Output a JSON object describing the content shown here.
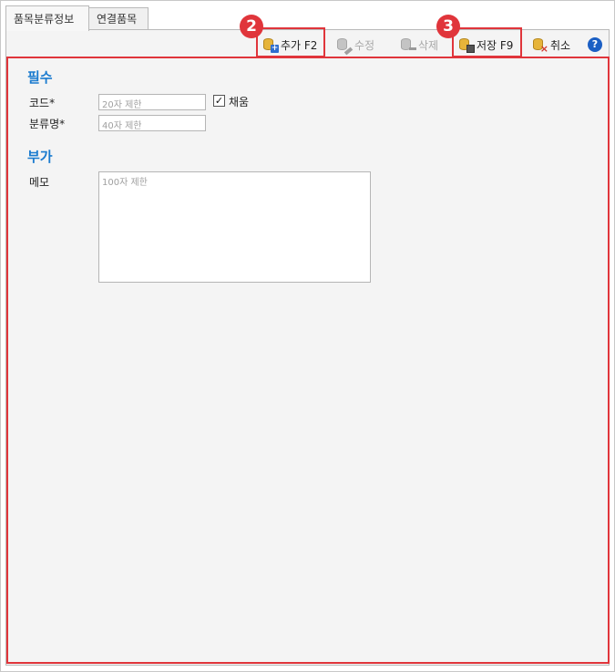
{
  "tabs": [
    {
      "label": "품목분류정보",
      "active": true
    },
    {
      "label": "연결품목",
      "active": false
    }
  ],
  "toolbar": {
    "add_label": "추가 F2",
    "edit_label": "수정",
    "delete_label": "삭제",
    "save_label": "저장 F9",
    "cancel_label": "취소",
    "help_glyph": "?"
  },
  "callouts": {
    "marker_2": "2",
    "marker_3": "3",
    "color": "#e0353b"
  },
  "required_section": {
    "title": "필수",
    "code": {
      "label": "코드",
      "required_mark": "*",
      "placeholder": "20자 제한"
    },
    "name": {
      "label": "분류명",
      "required_mark": "*",
      "placeholder": "40자 제한"
    },
    "auto_number": {
      "label": "채움",
      "checked": true,
      "check_glyph": "✓"
    }
  },
  "optional_section": {
    "title": "부가",
    "memo": {
      "label": "메모",
      "placeholder": "100자 제한"
    }
  },
  "colors": {
    "section_title": "#1a7bcf",
    "help_icon": "#1b5fc4",
    "panel_bg": "#f4f4f4"
  }
}
